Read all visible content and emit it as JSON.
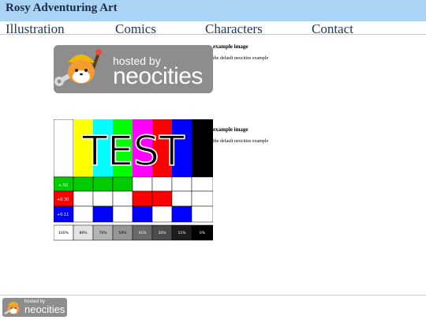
{
  "site": {
    "title": "Rosy Adventuring Art"
  },
  "nav": {
    "items": [
      {
        "label": "Illustration"
      },
      {
        "label": "Comics"
      },
      {
        "label": "Characters"
      },
      {
        "label": "Contact"
      }
    ]
  },
  "cards": [
    {
      "title": "example image",
      "description": "the default neocities example",
      "banner_hosted": "hosted by",
      "banner_brand": "neocities"
    },
    {
      "title": "example image",
      "description": "the default neocities example",
      "test_text": "TEST",
      "value_labels": [
        "+.50",
        "+0.30",
        "+0.11"
      ],
      "grayscale": [
        "100%",
        "89%",
        "70%",
        "59%",
        "41%",
        "30%",
        "11%",
        "0%"
      ]
    }
  ],
  "footer": {
    "badge_hosted": "hosted by",
    "badge_brand": "neocities"
  },
  "colors": {
    "header_bg": "#a9d4f5",
    "nav_text": "#1f3a66",
    "badge_bg": "#8d8d8d"
  }
}
